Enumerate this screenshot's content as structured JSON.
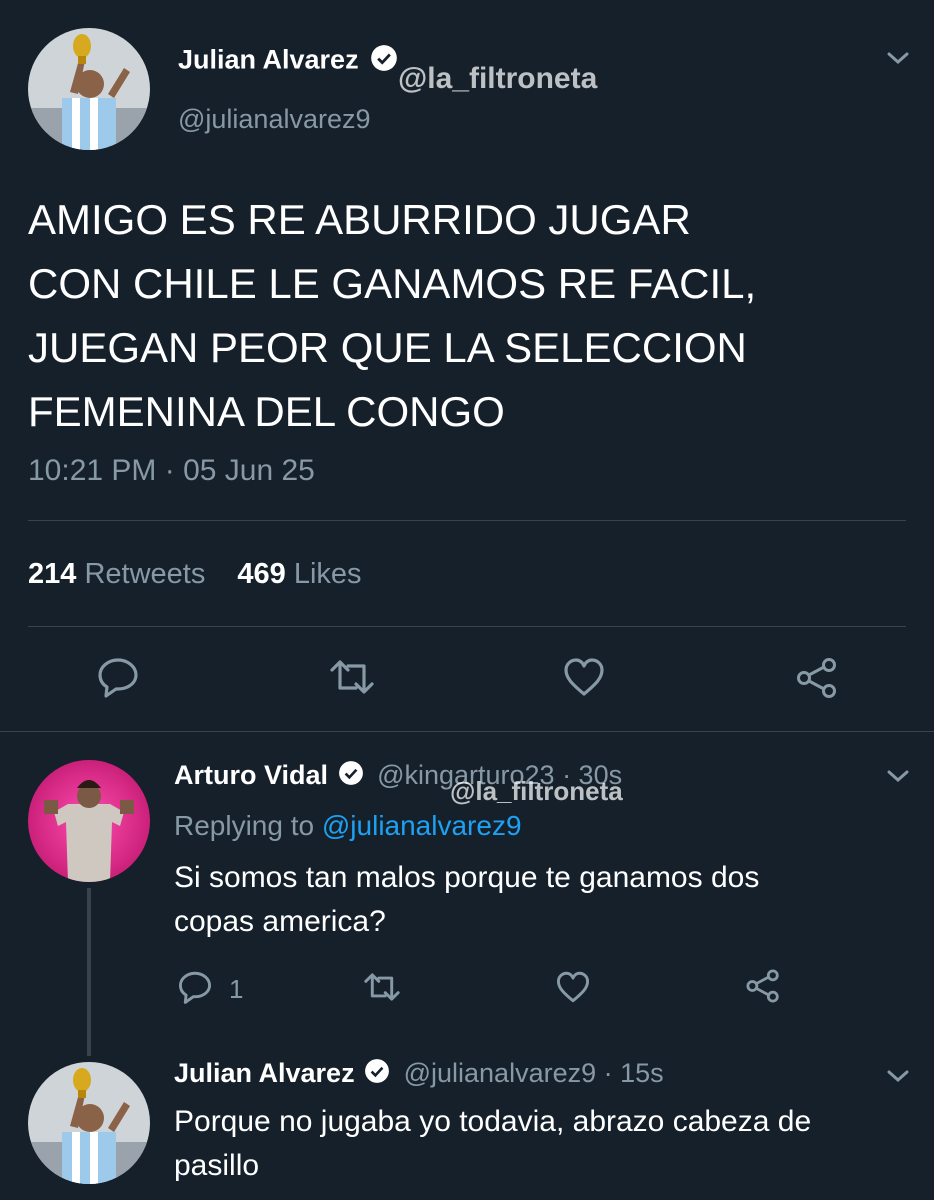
{
  "main_tweet": {
    "display_name": "Julian Alvarez",
    "handle": "@julianalvarez9",
    "text_lines": [
      "AMIGO ES RE ABURRIDO JUGAR",
      "CON CHILE LE GANAMOS RE FACIL,",
      "JUEGAN PEOR QUE LA SELECCION",
      "FEMENINA DEL CONGO"
    ],
    "timestamp": "10:21 PM · 05 Jun 25",
    "retweets_count": "214",
    "retweets_label": "Retweets",
    "likes_count": "469",
    "likes_label": "Likes"
  },
  "watermark": {
    "text": "@la_filtroneta"
  },
  "reply_1": {
    "display_name": "Arturo Vidal",
    "handle_time": "@kingarturo23 · 30s",
    "replying_prefix": "Replying to",
    "replying_handle": "@julianalvarez9",
    "text_lines": [
      "Si somos tan malos porque te ganamos dos",
      "copas america?"
    ],
    "reply_count": "1"
  },
  "reply_2": {
    "display_name": "Julian Alvarez",
    "handle_time": "@julianalvarez9 · 15s",
    "text_lines": [
      "Porque no jugaba yo todavia, abrazo cabeza de",
      "pasillo"
    ]
  },
  "icons": {
    "comment": "comment-icon",
    "retweet": "retweet-icon",
    "like": "heart-icon",
    "share": "share-icon",
    "more": "chevron-down-icon",
    "verified": "verified-badge-icon"
  },
  "colors": {
    "background": "#15202b",
    "text": "#ffffff",
    "muted": "#8899a6",
    "link": "#1da1f2",
    "divider": "#38444d"
  }
}
